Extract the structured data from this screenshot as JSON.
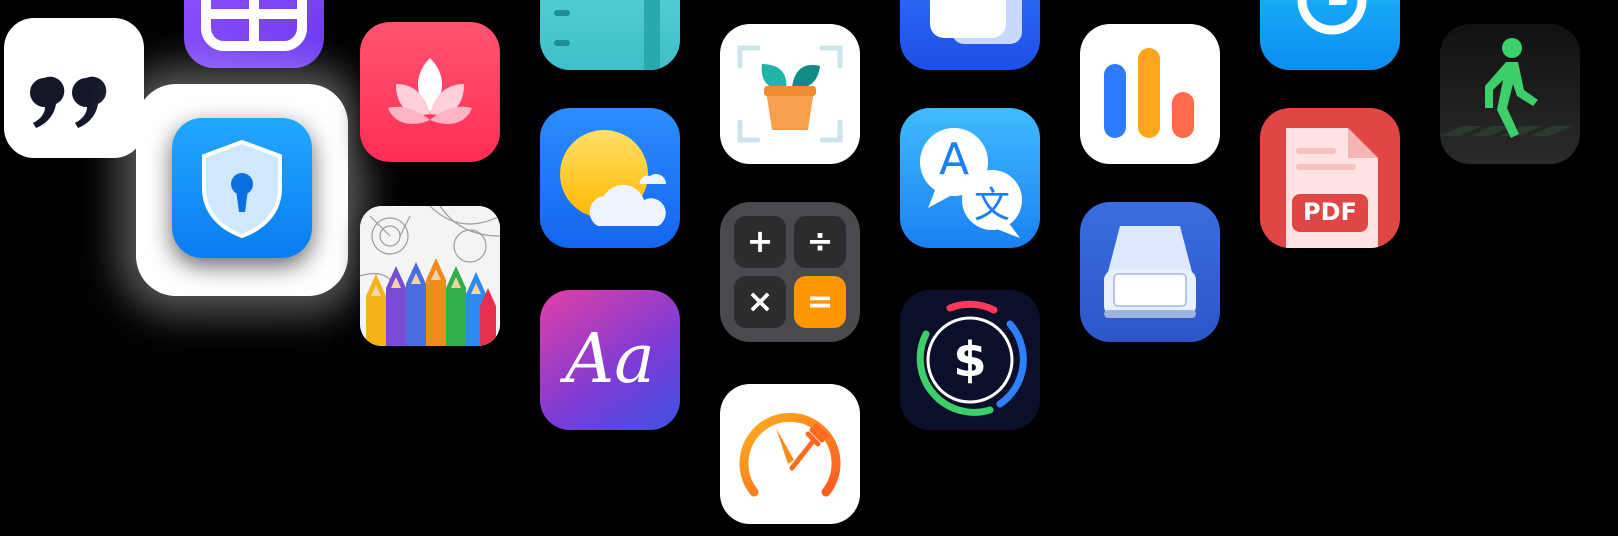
{
  "icons": [
    {
      "id": "quote",
      "name": "quote-icon",
      "color": "#ffffff"
    },
    {
      "id": "widget",
      "name": "widget-layout-icon",
      "color": "#7b44f5"
    },
    {
      "id": "shield",
      "name": "shield-lock-icon",
      "color": "#1493ff"
    },
    {
      "id": "lotus",
      "name": "lotus-icon",
      "color": "#ff3b5c"
    },
    {
      "id": "pencils",
      "name": "coloring-pencils-icon",
      "color": "#f4f4f4"
    },
    {
      "id": "notebook",
      "name": "notebook-icon",
      "color": "#4fc8cf"
    },
    {
      "id": "weather",
      "name": "weather-sun-cloud-icon",
      "color": "#1e78f7"
    },
    {
      "id": "font",
      "name": "font-aa-icon",
      "color": "#a43bbf",
      "glyph": "Aa"
    },
    {
      "id": "plant",
      "name": "plant-scan-icon",
      "color": "#ffffff"
    },
    {
      "id": "calc",
      "name": "calculator-icon",
      "color": "#4a4a4e",
      "keys": [
        "+",
        "÷",
        "×",
        "="
      ]
    },
    {
      "id": "timer",
      "name": "fasting-timer-icon",
      "color": "#ffffff"
    },
    {
      "id": "trans1",
      "name": "translate-cards-icon",
      "color": "#2a63f5"
    },
    {
      "id": "trans2",
      "name": "translate-bubbles-icon",
      "color": "#2a9cf8",
      "glyphs": [
        "A",
        "文"
      ]
    },
    {
      "id": "money",
      "name": "budget-dollar-icon",
      "color": "#0b0f2a",
      "glyph": "$"
    },
    {
      "id": "bars",
      "name": "bar-chart-icon",
      "color": "#ffffff"
    },
    {
      "id": "scanner",
      "name": "document-scanner-icon",
      "color": "#3462d6"
    },
    {
      "id": "clock",
      "name": "clock-icon",
      "color": "#18a8fa"
    },
    {
      "id": "pdf",
      "name": "pdf-file-icon",
      "color": "#e04646",
      "glyph": "PDF"
    },
    {
      "id": "walk",
      "name": "pedestrian-walk-icon",
      "color": "#1c1c1c"
    }
  ],
  "font": {
    "glyph": "Aa"
  },
  "calc": {
    "k1": "+",
    "k2": "÷",
    "k3": "×",
    "k4": "="
  },
  "trans2": {
    "a": "A",
    "b": "文"
  },
  "money": {
    "glyph": "$"
  },
  "pdf": {
    "glyph": "PDF"
  }
}
